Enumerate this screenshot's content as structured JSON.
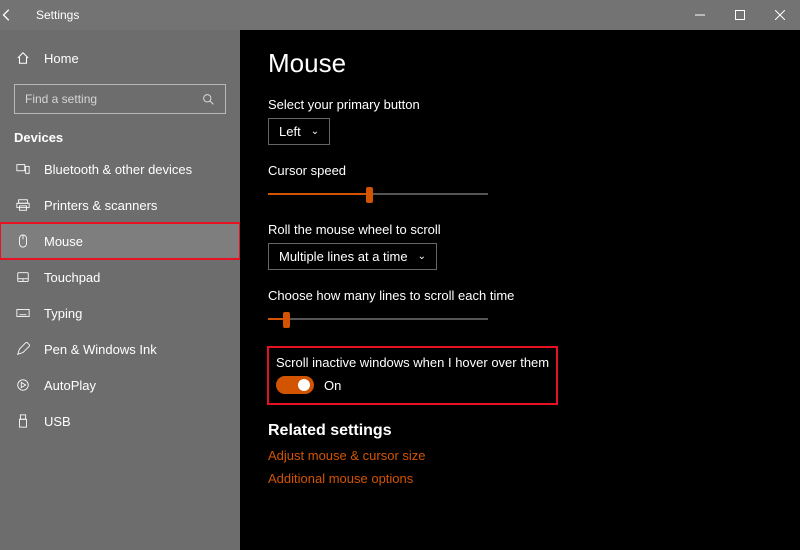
{
  "window": {
    "title": "Settings"
  },
  "sidebar": {
    "home": "Home",
    "search_placeholder": "Find a setting",
    "category": "Devices",
    "items": [
      {
        "label": "Bluetooth & other devices"
      },
      {
        "label": "Printers & scanners"
      },
      {
        "label": "Mouse"
      },
      {
        "label": "Touchpad"
      },
      {
        "label": "Typing"
      },
      {
        "label": "Pen & Windows Ink"
      },
      {
        "label": "AutoPlay"
      },
      {
        "label": "USB"
      }
    ]
  },
  "main": {
    "title": "Mouse",
    "primary_button_label": "Select your primary button",
    "primary_button_value": "Left",
    "cursor_speed_label": "Cursor speed",
    "cursor_speed_percent": 46,
    "wheel_label": "Roll the mouse wheel to scroll",
    "wheel_value": "Multiple lines at a time",
    "lines_label": "Choose how many lines to scroll each time",
    "lines_percent": 8,
    "inactive_label": "Scroll inactive windows when I hover over them",
    "inactive_state": "On",
    "related_heading": "Related settings",
    "link1": "Adjust mouse & cursor size",
    "link2": "Additional mouse options"
  },
  "colors": {
    "accent": "#d35400"
  }
}
